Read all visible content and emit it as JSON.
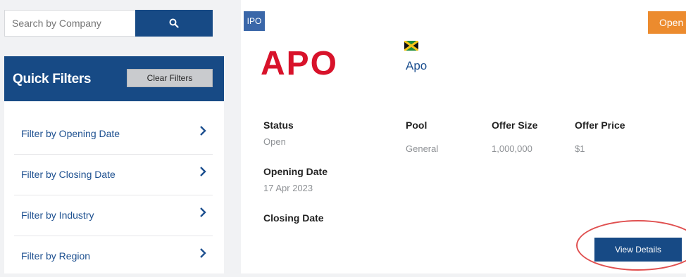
{
  "sidebar": {
    "search": {
      "placeholder": "Search by Company",
      "button_icon": "search-icon"
    },
    "quick_filters": {
      "title": "Quick Filters",
      "clear_label": "Clear Filters",
      "items": [
        {
          "label": "Filter by Opening Date"
        },
        {
          "label": "Filter by Closing Date"
        },
        {
          "label": "Filter by Industry"
        },
        {
          "label": "Filter by Region"
        }
      ]
    }
  },
  "card": {
    "type_tag": "IPO",
    "status_tag": "Open",
    "logo_text": "APO",
    "company_name": "Apo",
    "flag": "jamaica-flag",
    "fields": {
      "status_label": "Status",
      "status_value": "Open",
      "pool_label": "Pool",
      "pool_value": "General",
      "offer_size_label": "Offer Size",
      "offer_size_value": "1,000,000",
      "offer_price_label": "Offer Price",
      "offer_price_value": "$1",
      "opening_date_label": "Opening Date",
      "opening_date_value": "17 Apr 2023",
      "closing_date_label": "Closing Date"
    },
    "view_details_label": "View Details"
  },
  "colors": {
    "primary": "#174a85",
    "accent_orange": "#ec8b2e",
    "logo_red": "#d8122a",
    "highlight_circle": "#e05050"
  }
}
